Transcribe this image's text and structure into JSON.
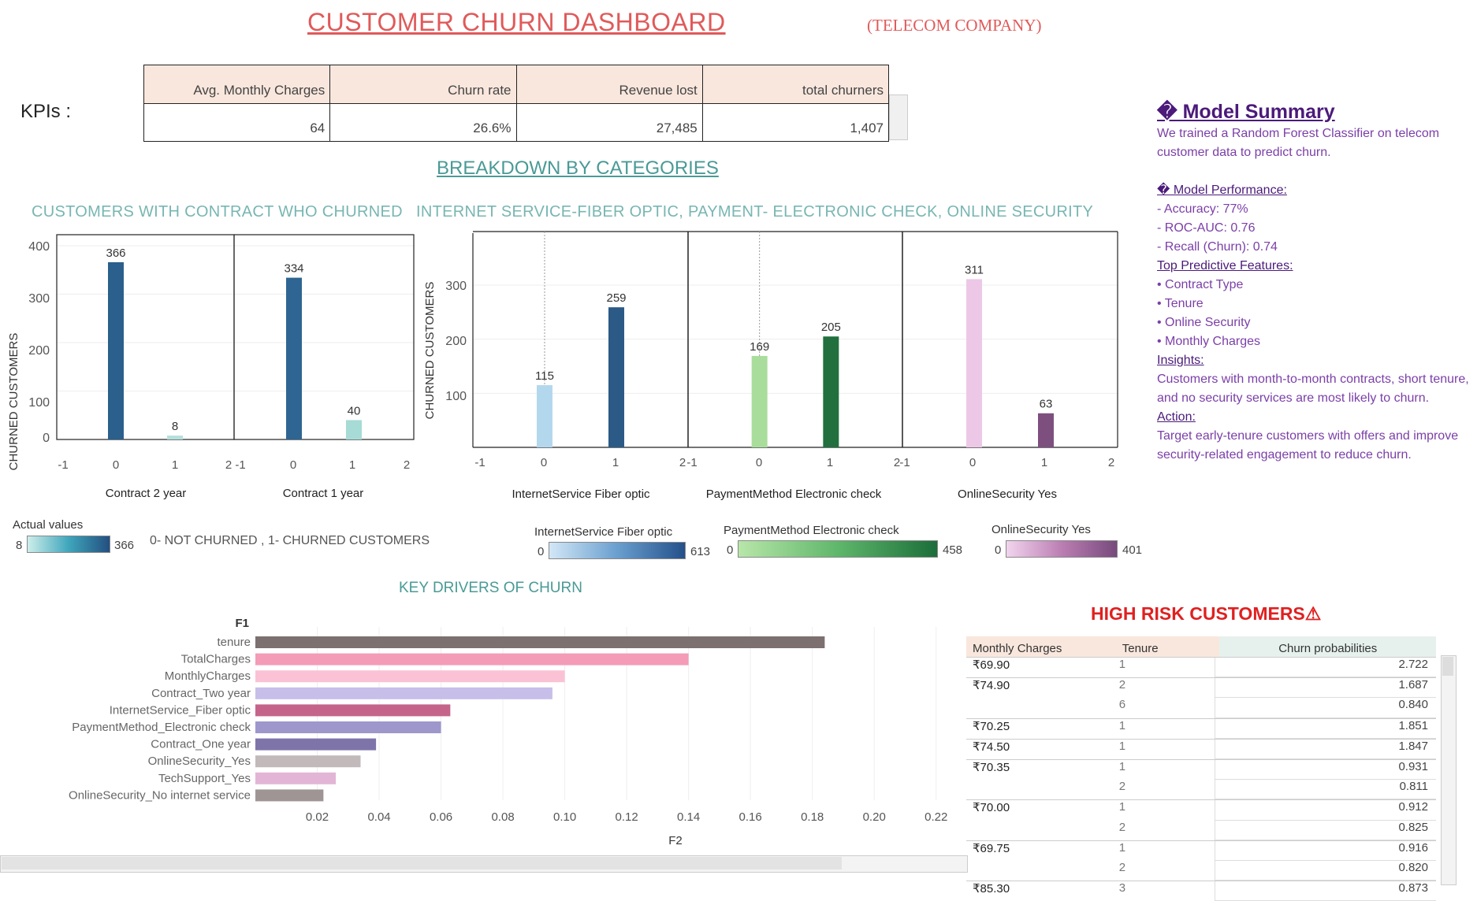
{
  "header": {
    "title": "CUSTOMER CHURN DASHBOARD",
    "subtitle": "(TELECOM COMPANY)",
    "kpis_label": "KPIs :"
  },
  "kpis": {
    "headers": [
      "Avg. Monthly Charges",
      "Churn rate",
      "Revenue lost",
      "total churners"
    ],
    "values": [
      "64",
      "26.6%",
      "27,485",
      "1,407"
    ]
  },
  "breakdown_title": "BREAKDOWN BY CATEGORIES",
  "contract_chart": {
    "heading": "CUSTOMERS WITH CONTRACT WHO CHURNED",
    "y_axis_label": "CHURNED CUSTOMERS",
    "y_ticks": [
      "400",
      "300",
      "200",
      "100",
      "0"
    ],
    "x_ticks": [
      "-1",
      "0",
      "1",
      "2"
    ],
    "panels": [
      "Contract 2 year",
      "Contract 1 year"
    ]
  },
  "services_chart": {
    "heading": "INTERNET SERVICE-FIBER OPTIC, PAYMENT- ELECTRONIC CHECK, ONLINE SECURITY",
    "y_axis_label": "CHURNED CUSTOMERS",
    "y_ticks": [
      "300",
      "200",
      "100"
    ],
    "x_ticks": [
      "-1",
      "0",
      "1",
      "2"
    ],
    "panels": [
      "InternetService Fiber optic",
      "PaymentMethod Electronic check",
      "OnlineSecurity Yes"
    ]
  },
  "legends": {
    "actual_values": {
      "title": "Actual values",
      "min": "8",
      "max": "366"
    },
    "note": "0- NOT CHURNED  , 1- CHURNED CUSTOMERS",
    "fiber": {
      "title": "InternetService Fiber optic",
      "min": "0",
      "max": "613"
    },
    "payment": {
      "title": "PaymentMethod Electronic check",
      "min": "0",
      "max": "458"
    },
    "security": {
      "title": "OnlineSecurity Yes",
      "min": "0",
      "max": "401"
    }
  },
  "drivers_chart": {
    "heading": "KEY DRIVERS OF CHURN",
    "y_axis_title": "F1",
    "x_axis_title": "F2",
    "x_ticks": [
      "0.02",
      "0.04",
      "0.06",
      "0.08",
      "0.10",
      "0.12",
      "0.14",
      "0.16",
      "0.18",
      "0.20",
      "0.22"
    ]
  },
  "model_summary": {
    "title": "� Model Summary",
    "intro": "We  trained a Random Forest Classifier on telecom customer data to predict churn.",
    "performance_title": "� Model Performance:",
    "performance": [
      "- Accuracy: 77%",
      "- ROC-AUC: 0.76",
      "- Recall (Churn): 0.74"
    ],
    "features_title": " Top Predictive Features:",
    "features": [
      "• Contract Type",
      "• Tenure",
      "• Online Security",
      "• Monthly Charges"
    ],
    "insights_title": "Insights:",
    "insights": "Customers with month-to-month contracts, short tenure, and no security services are most likely to churn.",
    "action_title": " Action:",
    "action": "Target early-tenure customers with offers and improve security-related engagement to reduce churn."
  },
  "high_risk": {
    "title": "HIGH RISK CUSTOMERS⚠",
    "headers": [
      "Monthly Charges",
      "Tenure",
      "Churn probabilities"
    ],
    "rows": [
      {
        "charge": "₹69.90",
        "tenure": "1",
        "prob": "2.722"
      },
      {
        "charge": "₹74.90",
        "tenure": "2",
        "prob": "1.687"
      },
      {
        "charge": "",
        "tenure": "6",
        "prob": "0.840"
      },
      {
        "charge": "₹70.25",
        "tenure": "1",
        "prob": "1.851"
      },
      {
        "charge": "₹74.50",
        "tenure": "1",
        "prob": "1.847"
      },
      {
        "charge": "₹70.35",
        "tenure": "1",
        "prob": "0.931"
      },
      {
        "charge": "",
        "tenure": "2",
        "prob": "0.811"
      },
      {
        "charge": "₹70.00",
        "tenure": "1",
        "prob": "0.912"
      },
      {
        "charge": "",
        "tenure": "2",
        "prob": "0.825"
      },
      {
        "charge": "₹69.75",
        "tenure": "1",
        "prob": "0.916"
      },
      {
        "charge": "",
        "tenure": "2",
        "prob": "0.820"
      },
      {
        "charge": "₹85.30",
        "tenure": "3",
        "prob": "0.873"
      }
    ],
    "header_colors": {
      "charges": "#f9e7dd",
      "tenure": "#f9e7dd",
      "prob": "#e6f1ee"
    }
  },
  "chart_data": [
    {
      "type": "bar",
      "title": "CUSTOMERS WITH CONTRACT WHO CHURNED",
      "ylabel": "CHURNED CUSTOMERS",
      "ylim": [
        0,
        400
      ],
      "xlim": [
        -1,
        2
      ],
      "panels": [
        {
          "name": "Contract 2 year",
          "x": [
            0,
            1
          ],
          "values": [
            366,
            8
          ],
          "colors": [
            "#2b5f8c",
            "#b4e0dc"
          ]
        },
        {
          "name": "Contract 1 year",
          "x": [
            0,
            1
          ],
          "values": [
            334,
            40
          ],
          "colors": [
            "#2e6592",
            "#a7dbd5"
          ]
        }
      ]
    },
    {
      "type": "bar",
      "title": "INTERNET SERVICE-FIBER OPTIC, PAYMENT- ELECTRONIC CHECK, ONLINE SECURITY",
      "ylabel": "CHURNED CUSTOMERS",
      "ylim": [
        0,
        380
      ],
      "xlim": [
        -1,
        2
      ],
      "panels": [
        {
          "name": "InternetService Fiber optic",
          "x": [
            0,
            1
          ],
          "values": [
            115,
            259
          ],
          "colors": [
            "#b3d8ee",
            "#2b5a87"
          ]
        },
        {
          "name": "PaymentMethod Electronic check",
          "x": [
            0,
            1
          ],
          "values": [
            169,
            205
          ],
          "colors": [
            "#a9dd9c",
            "#21703e"
          ]
        },
        {
          "name": "OnlineSecurity Yes",
          "x": [
            0,
            1
          ],
          "values": [
            311,
            63
          ],
          "colors": [
            "#ecc8e6",
            "#7d4f7e"
          ]
        }
      ]
    },
    {
      "type": "bar",
      "orientation": "horizontal",
      "title": "KEY DRIVERS OF CHURN",
      "ylabel": "F1",
      "xlabel": "F2",
      "xlim": [
        0,
        0.23
      ],
      "categories": [
        "tenure",
        "TotalCharges",
        "MonthlyCharges",
        "Contract_Two year",
        "InternetService_Fiber optic",
        "PaymentMethod_Electronic check",
        "Contract_One year",
        "OnlineSecurity_Yes",
        "TechSupport_Yes",
        "OnlineSecurity_No internet service"
      ],
      "values": [
        0.184,
        0.14,
        0.1,
        0.096,
        0.063,
        0.06,
        0.039,
        0.034,
        0.026,
        0.022
      ],
      "colors": [
        "#7d7070",
        "#f49bb8",
        "#fbc2d6",
        "#c7bfe9",
        "#c5648b",
        "#9e97cc",
        "#7f74aa",
        "#c1b9ba",
        "#e2b5d6",
        "#a09595"
      ]
    }
  ]
}
